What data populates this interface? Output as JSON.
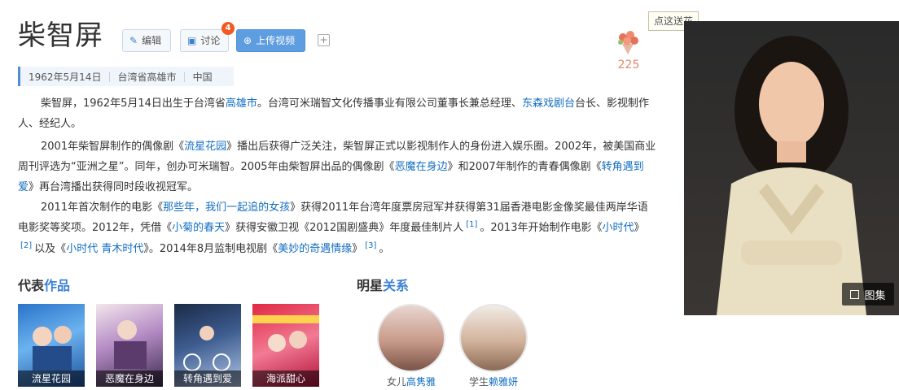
{
  "title": "柴智屏",
  "toolbar": {
    "edit_label": "编辑",
    "discuss_label": "讨论",
    "discuss_badge": "4",
    "upload_label": "上传视频",
    "more_label": "+"
  },
  "flower": {
    "tip": "点这送花",
    "count": "225"
  },
  "infobar": {
    "birth": "1962年5月14日",
    "place": "台湾省高雄市",
    "country": "中国"
  },
  "paragraphs": {
    "p1": {
      "t1": "柴智屏，1962年5月14日出生于台湾省",
      "l1": "高雄市",
      "t2": "。台湾可米瑞智文化传播事业有限公司董事长兼总经理、",
      "l2": "东森戏剧台",
      "t3": "台长、影视制作人、经纪人。"
    },
    "p2": {
      "t1": "2001年柴智屏制作的偶像剧《",
      "l1": "流星花园",
      "t2": "》播出后获得广泛关注，柴智屏正式以影视制作人的身份进入娱乐圈。2002年，被美国商业周刊评选为“亚洲之星”。同年，创办可米瑞智。2005年由柴智屏出品的偶像剧《",
      "l2": "恶魔在身边",
      "t3": "》和2007年制作的青春偶像剧《",
      "l3": "转角遇到爱",
      "t4": "》再台湾播出获得同时段收视冠军。"
    },
    "p3": {
      "t1": "2011年首次制作的电影《",
      "l1": "那些年，我们一起追的女孩",
      "t2": "》获得2011年台湾年度票房冠军并获得第31届香港电影金像奖最佳两岸华语电影奖等奖项。2012年，凭借《",
      "l2": "小菊的春天",
      "t3": "》获得安徽卫视《2012国剧盛典》年度最佳制片人",
      "ref1": "[1]",
      "t4": "。2013年开始制作电影《",
      "l3": "小时代",
      "t5": "》",
      "ref2": "[2]",
      "t6": "以及《",
      "l4": "小时代 青木时代",
      "t7": "》。2014年8月监制电视剧《",
      "l5": "美妙的奇遇情缘",
      "t8": "》",
      "ref3": "[3]",
      "t9": "。"
    }
  },
  "works_section": {
    "title_plain": "代表",
    "title_hl": "作品"
  },
  "works": [
    {
      "caption": "流星花园"
    },
    {
      "caption": "恶魔在身边"
    },
    {
      "caption": "转角遇到爱"
    },
    {
      "caption": "海派甜心"
    }
  ],
  "relations_section": {
    "title_plain": "明星",
    "title_hl": "关系"
  },
  "relations": [
    {
      "relation": "女儿",
      "name": "高隽雅"
    },
    {
      "relation": "学生",
      "name": "赖雅妍"
    }
  ],
  "photo": {
    "gallery_label": "图集"
  },
  "colors": {
    "link": "#136ec2",
    "accent": "#3b82d6",
    "upload_button": "#5e9de0",
    "badge": "#f05a23"
  }
}
